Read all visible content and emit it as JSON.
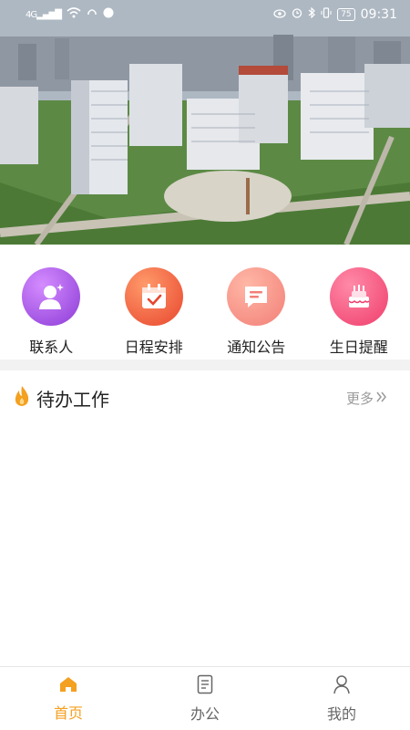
{
  "status_bar": {
    "network": "4G",
    "battery": "75",
    "time": "09:31"
  },
  "banner": {
    "icon": "city-banner-image"
  },
  "quick_actions": [
    {
      "label": "联系人",
      "icon": "contacts-icon",
      "color": "#a24de6"
    },
    {
      "label": "日程安排",
      "icon": "calendar-icon",
      "color": "#f0623d"
    },
    {
      "label": "通知公告",
      "icon": "notice-icon",
      "color": "#f48e84"
    },
    {
      "label": "生日提醒",
      "icon": "birthday-cake-icon",
      "color": "#f24f78"
    }
  ],
  "todo": {
    "title": "待办工作",
    "more_label": "更多",
    "icon": "flame-icon",
    "accent": "#f4a020"
  },
  "tabbar": {
    "items": [
      {
        "label": "首页",
        "icon": "home-icon",
        "active": true
      },
      {
        "label": "办公",
        "icon": "document-icon",
        "active": false
      },
      {
        "label": "我的",
        "icon": "user-icon",
        "active": false
      }
    ],
    "active_color": "#f4a020"
  }
}
